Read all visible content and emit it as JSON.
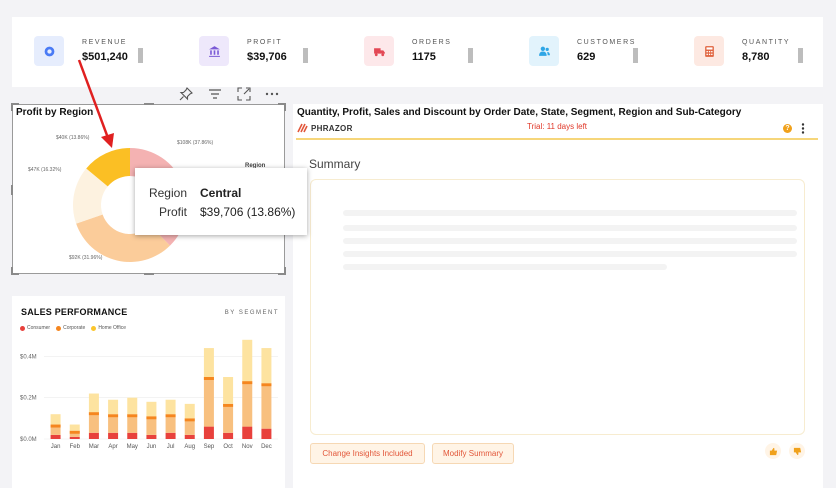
{
  "kpis": [
    {
      "label": "REVENUE",
      "value": "$501,240",
      "icon": "coin-icon",
      "icon_color": "#4a7bf5",
      "icon_bg": "#e6edfd"
    },
    {
      "label": "PROFIT",
      "value": "$39,706",
      "icon": "bank-icon",
      "icon_color": "#7b5ad6",
      "icon_bg": "#eee8fb"
    },
    {
      "label": "ORDERS",
      "value": "1175",
      "icon": "truck-icon",
      "icon_color": "#e34855",
      "icon_bg": "#fde8ea"
    },
    {
      "label": "CUSTOMERS",
      "value": "629",
      "icon": "users-icon",
      "icon_color": "#2fa6e6",
      "icon_bg": "#e2f3fc"
    },
    {
      "label": "QUANTITY",
      "value": "8,780",
      "icon": "calculator-icon",
      "icon_color": "#e0613c",
      "icon_bg": "#fde9e2"
    }
  ],
  "region_card": {
    "title": "Profit by Region",
    "legend_title": "Region",
    "tooltip": {
      "key1": "Region",
      "val1": "Central",
      "key2": "Profit",
      "val2": "$39,706 (13.86%)"
    }
  },
  "chart_data": [
    {
      "type": "pie",
      "title": "Profit by Region",
      "legend_title": "Region",
      "labels": [
        "$108K (37.86%)",
        "$92K (31.96%)",
        "$47K (16.32%)",
        "$40K (13.86%)"
      ],
      "values": [
        108,
        92,
        47,
        40
      ],
      "colors": [
        "#f4b2b2",
        "#fbcc9a",
        "#fdf2e0",
        "#fbbf24"
      ]
    },
    {
      "type": "bar",
      "title": "SALES PERFORMANCE",
      "subtitle": "BY SEGMENT",
      "categories": [
        "Jan",
        "Feb",
        "Mar",
        "Apr",
        "May",
        "Jun",
        "Jul",
        "Aug",
        "Sep",
        "Oct",
        "Nov",
        "Dec"
      ],
      "series": [
        {
          "name": "Consumer",
          "color": "#e8413c",
          "values": [
            0.02,
            0.01,
            0.03,
            0.03,
            0.03,
            0.02,
            0.03,
            0.02,
            0.06,
            0.03,
            0.06,
            0.05
          ]
        },
        {
          "name": "Corporate",
          "color": "#f5861f",
          "values": [
            0.05,
            0.03,
            0.1,
            0.09,
            0.09,
            0.09,
            0.09,
            0.08,
            0.24,
            0.14,
            0.22,
            0.22
          ]
        },
        {
          "name": "Home Office",
          "color": "#fbc52c",
          "values": [
            0.05,
            0.03,
            0.09,
            0.07,
            0.08,
            0.07,
            0.07,
            0.07,
            0.14,
            0.13,
            0.2,
            0.17
          ]
        }
      ],
      "yticks": [
        "$0.0M",
        "$0.2M",
        "$0.4M"
      ],
      "ylim": [
        0,
        0.45
      ],
      "stacked": true
    }
  ],
  "sales_card": {
    "title": "SALES PERFORMANCE",
    "subtitle": "BY SEGMENT"
  },
  "right_panel": {
    "title": "Quantity, Profit, Sales and Discount by Order Date, State, Segment, Region and Sub-Category",
    "brand": "PHRAZOR",
    "trial": "Trial: 11 days left",
    "summary_heading": "Summary",
    "btn_insights": "Change Insights Included",
    "btn_modify": "Modify Summary"
  }
}
